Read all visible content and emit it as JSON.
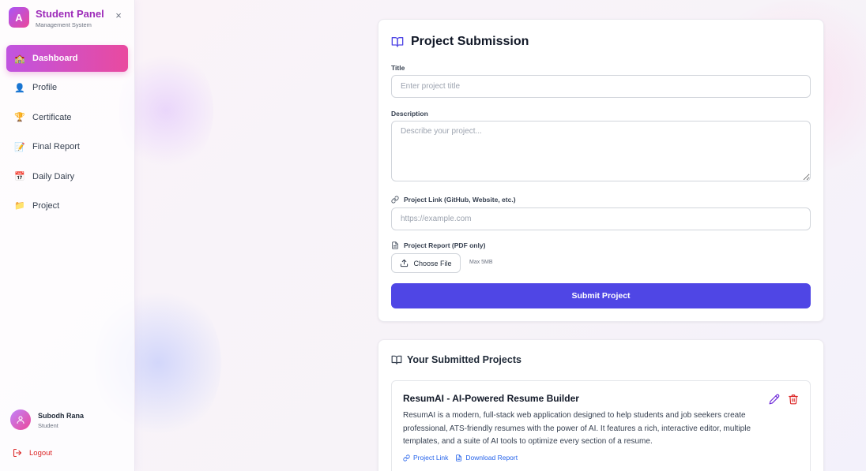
{
  "sidebar": {
    "brand_letter": "A",
    "brand_title": "Student Panel",
    "brand_subtitle": "Management System",
    "close_glyph": "×",
    "items": [
      {
        "label": "Dashboard",
        "icon": "school-emoji",
        "glyph": "🏫",
        "active": true
      },
      {
        "label": "Profile",
        "icon": "person-silhouette-emoji",
        "glyph": "👤",
        "active": false
      },
      {
        "label": "Certificate",
        "icon": "trophy-emoji",
        "glyph": "🏆",
        "active": false
      },
      {
        "label": "Final Report",
        "icon": "memo-emoji",
        "glyph": "📝",
        "active": false
      },
      {
        "label": "Daily Dairy",
        "icon": "calendar-emoji",
        "glyph": "📅",
        "active": false
      },
      {
        "label": "Project",
        "icon": "folder-emoji",
        "glyph": "📁",
        "active": false
      }
    ],
    "user": {
      "name": "Subodh Rana",
      "role": "Student"
    },
    "logout_label": "Logout"
  },
  "submission": {
    "title": "Project Submission",
    "title_label": "Title",
    "title_placeholder": "Enter project title",
    "description_label": "Description",
    "description_placeholder": "Describe your project...",
    "link_label": "Project Link (GitHub, Website, etc.)",
    "link_placeholder": "https://example.com",
    "report_label": "Project Report (PDF only)",
    "choose_file_label": "Choose File",
    "max_size": "Max 5MB",
    "submit_label": "Submit Project"
  },
  "submitted": {
    "title": "Your Submitted Projects",
    "projects": [
      {
        "title": "ResumAI - AI-Powered Resume Builder",
        "description": "ResumAI is a modern, full-stack web application designed to help students and job seekers create professional, ATS-friendly resumes with the power of AI. It features a rich, interactive editor, multiple templates, and a suite of AI tools to optimize every section of a resume.",
        "link_label": "Project Link",
        "report_label": "Download Report"
      }
    ]
  },
  "colors": {
    "accent": "#4f46e5",
    "brand_gradient_start": "#c054e0",
    "brand_gradient_end": "#e94a9f",
    "danger": "#dc2626",
    "link": "#2563eb"
  }
}
